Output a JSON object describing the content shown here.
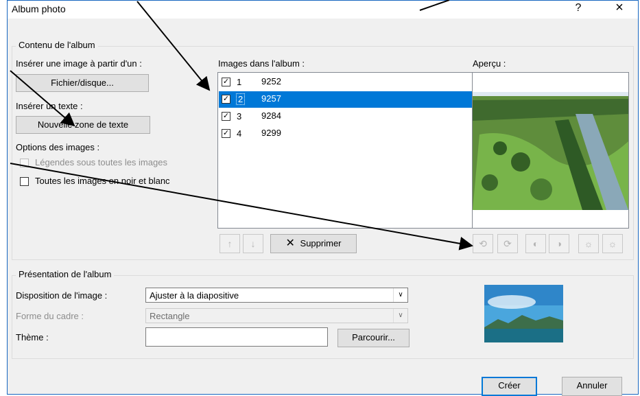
{
  "dialog": {
    "title": "Album photo",
    "help_label": "?",
    "close_label": "×"
  },
  "content_group": {
    "legend": "Contenu de l'album",
    "insert_image_label": "Insérer une image à partir d'un :",
    "file_button": "Fichier/disque...",
    "insert_text_label": "Insérer un texte :",
    "new_textbox_button": "Nouvelle zone de texte",
    "image_options_label": "Options des images :",
    "captions_option": "Légendes sous toutes les images",
    "captions_checked": false,
    "bw_option": "Toutes les images en noir et blanc",
    "bw_checked": false
  },
  "album_list": {
    "label": "Images dans l'album :",
    "items": [
      {
        "index": "1",
        "name": "9252",
        "checked": "✓",
        "selected": false
      },
      {
        "index": "2",
        "name": "9257",
        "checked": "✓",
        "selected": true
      },
      {
        "index": "3",
        "name": "9284",
        "checked": "✓",
        "selected": false
      },
      {
        "index": "4",
        "name": "9299",
        "checked": "✓",
        "selected": false
      }
    ],
    "move_up_icon": "↑",
    "move_down_icon": "↓",
    "delete_button": "Supprimer",
    "delete_icon": "✕"
  },
  "preview": {
    "label": "Aperçu :"
  },
  "layout_group": {
    "legend": "Présentation de l'album",
    "image_layout_label": "Disposition de l'image :",
    "image_layout_value": "Ajuster à la diapositive",
    "frame_shape_label": "Forme du cadre :",
    "frame_shape_value": "Rectangle",
    "theme_label": "Thème :",
    "theme_value": "",
    "browse_button": "Parcourir..."
  },
  "footer": {
    "create_button": "Créer",
    "cancel_button": "Annuler"
  },
  "colors": {
    "selection": "#0078d7",
    "dialog_border": "#1565c0",
    "arrows": "#000000"
  }
}
